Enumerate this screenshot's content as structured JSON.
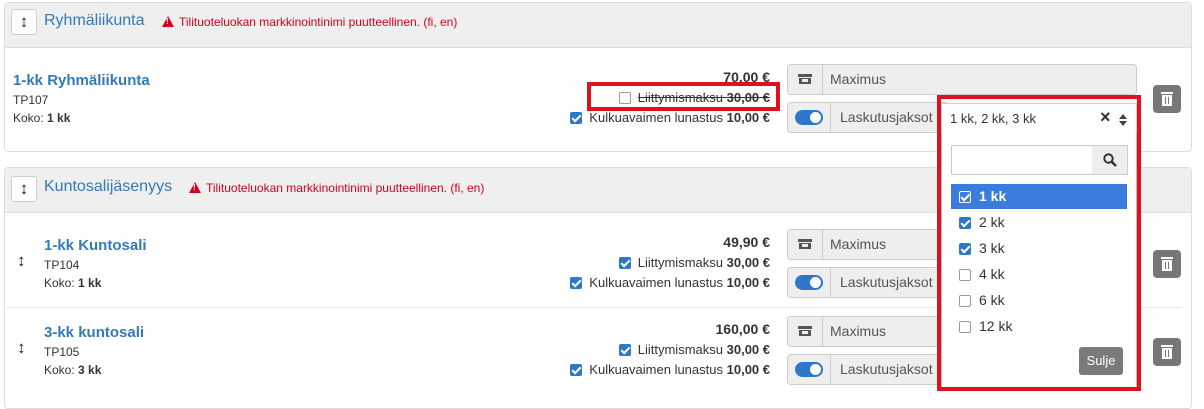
{
  "groups": [
    {
      "title": "Ryhmäliikunta",
      "warning": "Tilituoteluokan markkinointinimi puutteellinen. (fi, en)",
      "products": [
        {
          "name": "1-kk Ryhmäliikunta",
          "code": "TP107",
          "size_label": "Koko:",
          "size_value": "1 kk",
          "price": "70,00 €",
          "joining_fee_label": "Liittymismaksu",
          "joining_fee_value": "30,00 €",
          "joining_fee_checked": false,
          "key_fee_label": "Kulkuavaimen lunastus",
          "key_fee_value": "10,00 €",
          "key_fee_checked": true,
          "location": "Maximus",
          "billing_label": "Laskutusjaksot",
          "billing_value": "1 kk, 2 kk, 3 kk"
        }
      ]
    },
    {
      "title": "Kuntosalijäsenyys",
      "warning": "Tilituoteluokan markkinointinimi puutteellinen. (fi, en)",
      "products": [
        {
          "name": "1-kk Kuntosali",
          "code": "TP104",
          "size_label": "Koko:",
          "size_value": "1 kk",
          "price": "49,90 €",
          "joining_fee_label": "Liittymismaksu",
          "joining_fee_value": "30,00 €",
          "joining_fee_checked": true,
          "key_fee_label": "Kulkuavaimen lunastus",
          "key_fee_value": "10,00 €",
          "key_fee_checked": true,
          "location": "Maximus",
          "billing_label": "Laskutusjaksot"
        },
        {
          "name": "3-kk kuntosali",
          "code": "TP105",
          "size_label": "Koko:",
          "size_value": "3 kk",
          "price": "160,00 €",
          "joining_fee_label": "Liittymismaksu",
          "joining_fee_value": "30,00 €",
          "joining_fee_checked": true,
          "key_fee_label": "Kulkuavaimen lunastus",
          "key_fee_value": "10,00 €",
          "key_fee_checked": true,
          "location": "Maximus",
          "billing_label": "Laskutusjaksot"
        }
      ]
    }
  ],
  "dropdown": {
    "options": [
      {
        "label": "1 kk",
        "checked": true,
        "highlighted": true
      },
      {
        "label": "2 kk",
        "checked": true,
        "highlighted": false
      },
      {
        "label": "3 kk",
        "checked": true,
        "highlighted": false
      },
      {
        "label": "4 kk",
        "checked": false,
        "highlighted": false
      },
      {
        "label": "6 kk",
        "checked": false,
        "highlighted": false
      },
      {
        "label": "12 kk",
        "checked": false,
        "highlighted": false
      }
    ],
    "close_label": "Sulje",
    "clear_glyph": "×",
    "arrow_glyph": "⬍"
  },
  "icons": {
    "drag": "↕",
    "search": "search-icon",
    "store": "store-icon",
    "trash": "trash-icon",
    "warning": "warning-triangle-icon"
  },
  "colors": {
    "link": "#337ab7",
    "warning": "#d0021b",
    "checkbox": "#2f77c9",
    "highlight": "#e0101e"
  }
}
